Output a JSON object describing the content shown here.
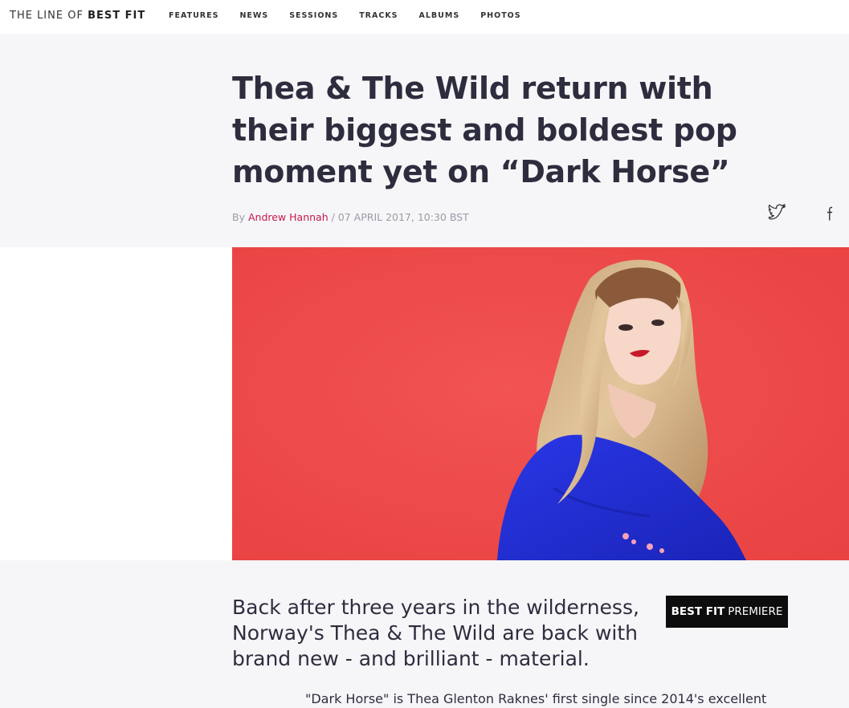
{
  "site": {
    "logo_prefix": "THE LINE OF",
    "logo_strong": "BEST FIT"
  },
  "nav": {
    "items": [
      "FEATURES",
      "NEWS",
      "SESSIONS",
      "TRACKS",
      "ALBUMS",
      "PHOTOS"
    ]
  },
  "article": {
    "title": "Thea & The Wild return with their biggest and boldest pop moment yet on “Dark Horse”",
    "byline_prefix": "By",
    "author": "Andrew Hannah",
    "date": "/ 07 APRIL 2017, 10:30 BST",
    "standfirst": "Back after three years in the wilderness, Norway's Thea & The Wild are back with brand new - and brilliant - material.",
    "badge_strong": "BEST FIT",
    "badge_text": "PREMIERE",
    "body_first_line": "\"Dark Horse\" is Thea Glenton Raknes' first single since 2014's excellent"
  },
  "share": {
    "twitter": "twitter-icon",
    "facebook": "facebook-icon"
  },
  "colors": {
    "accent": "#c8194a",
    "hero_bg": "#ef4848",
    "jacket": "#1f2fd8"
  }
}
